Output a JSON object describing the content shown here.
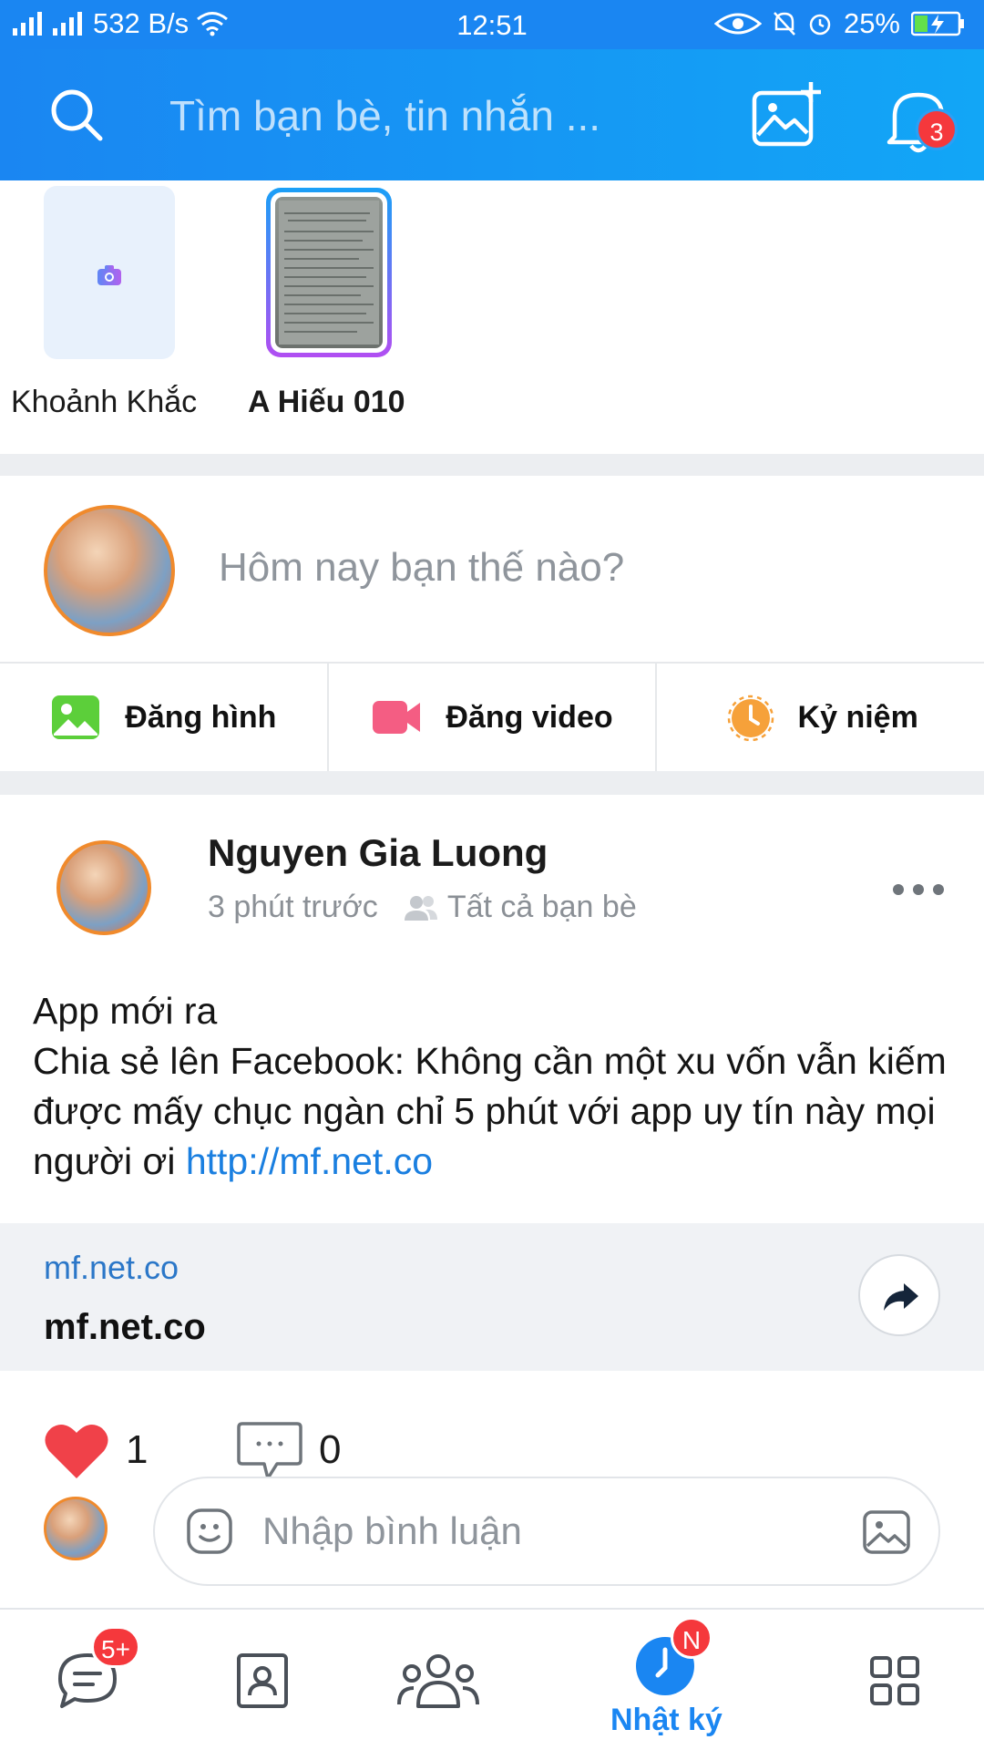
{
  "status_bar": {
    "net_speed": "532 B/s",
    "time": "12:51",
    "battery": "25%"
  },
  "header": {
    "search_placeholder": "Tìm bạn bè, tin nhắn ...",
    "notification_count": "3"
  },
  "stories": [
    {
      "label": "Khoảnh Khắc"
    },
    {
      "label": "A Hiếu 010"
    }
  ],
  "composer": {
    "prompt": "Hôm nay bạn thế nào?",
    "actions": [
      {
        "label": "Đăng hình",
        "icon": "image-icon"
      },
      {
        "label": "Đăng video",
        "icon": "video-icon"
      },
      {
        "label": "Kỷ niệm",
        "icon": "memory-clock-icon"
      }
    ]
  },
  "post": {
    "author": "Nguyen Gia Luong",
    "time": "3 phút trước",
    "audience": "Tất cả bạn bè",
    "text_line1": "App mới ra",
    "text_line2": "Chia sẻ lên Facebook: Không cần một xu vốn vẫn kiếm được mấy chục ngàn chỉ 5 phút với app uy tín này mọi người ơi ",
    "link_text": "http://mf.net.co",
    "link_card": {
      "domain": "mf.net.co",
      "title": "mf.net.co"
    },
    "likes": "1",
    "comments": "0",
    "comment_placeholder": "Nhập bình luận"
  },
  "bottom_nav": {
    "messages_badge": "5+",
    "diary_badge": "N",
    "diary_label": "Nhật ký"
  },
  "colors": {
    "brand_blue": "#1a86f2",
    "badge_red": "#f5383c",
    "link_blue": "#1a7fe0"
  }
}
